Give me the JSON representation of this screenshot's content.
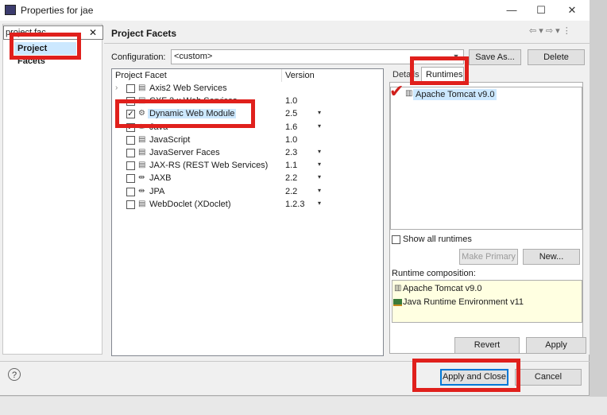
{
  "window": {
    "title": "Properties for jae",
    "minimize": "—",
    "maximize": "☐",
    "close": "✕"
  },
  "left": {
    "filter_value": "project fac",
    "clear": "✕",
    "tree_item": "Project Facets"
  },
  "header": {
    "title": "Project Facets",
    "nav": "⇦ ▾ ⇨ ▾ ⋮"
  },
  "config": {
    "label": "Configuration:",
    "value": "<custom>",
    "arrow": "▼",
    "save_as": "Save As...",
    "delete": "Delete"
  },
  "facets": {
    "col_facet": "Project Facet",
    "col_version": "Version",
    "rows": [
      {
        "label": "Axis2 Web Services",
        "version": "",
        "checked": false,
        "dropdown": false,
        "icon": "▤",
        "chev": "›"
      },
      {
        "label": "CXF 2.x Web Services",
        "version": "1.0",
        "checked": false,
        "dropdown": false,
        "icon": "▤",
        "chev": ""
      },
      {
        "label": "Dynamic Web Module",
        "version": "2.5",
        "checked": true,
        "dropdown": true,
        "icon": "⚙",
        "chev": ""
      },
      {
        "label": "Java",
        "version": "1.6",
        "checked": true,
        "dropdown": true,
        "icon": "☕",
        "chev": ""
      },
      {
        "label": "JavaScript",
        "version": "1.0",
        "checked": false,
        "dropdown": false,
        "icon": "▤",
        "chev": ""
      },
      {
        "label": "JavaServer Faces",
        "version": "2.3",
        "checked": false,
        "dropdown": true,
        "icon": "▤",
        "chev": ""
      },
      {
        "label": "JAX-RS (REST Web Services)",
        "version": "1.1",
        "checked": false,
        "dropdown": true,
        "icon": "▤",
        "chev": ""
      },
      {
        "label": "JAXB",
        "version": "2.2",
        "checked": false,
        "dropdown": true,
        "icon": "⇹",
        "chev": ""
      },
      {
        "label": "JPA",
        "version": "2.2",
        "checked": false,
        "dropdown": true,
        "icon": "⇹",
        "chev": ""
      },
      {
        "label": "WebDoclet (XDoclet)",
        "version": "1.2.3",
        "checked": false,
        "dropdown": true,
        "icon": "▤",
        "chev": ""
      }
    ],
    "check_glyph": "✓",
    "dropdown_glyph": "▾"
  },
  "side_tabs": {
    "details": "Details",
    "runtimes": "Runtimes"
  },
  "runtimes": {
    "items": [
      "Apache Tomcat v9.0"
    ],
    "check_glyph": "✔",
    "server_icon": "▥",
    "show_all": "Show all runtimes",
    "make_primary": "Make Primary",
    "new": "New...",
    "composition_label": "Runtime composition:",
    "composition": [
      "Apache Tomcat v9.0",
      "Java Runtime Environment v11"
    ]
  },
  "footer": {
    "help": "?",
    "revert": "Revert",
    "apply": "Apply",
    "apply_close": "Apply and Close",
    "cancel": "Cancel"
  },
  "colors": {
    "annotation_red": "#e0201c",
    "selection_blue": "#cce8ff"
  }
}
